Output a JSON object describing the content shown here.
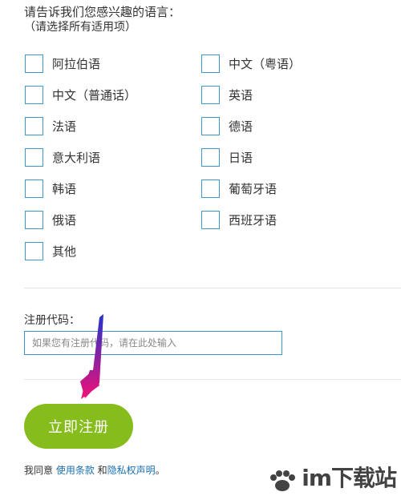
{
  "form": {
    "prompt": "请告诉我们您感兴趣的语言：",
    "prompt_sub": "（请选择所有适用项）",
    "languages": [
      {
        "label": "阿拉伯语",
        "checked": false
      },
      {
        "label": "中文（粤语）",
        "checked": false
      },
      {
        "label": "中文（普通话）",
        "checked": false
      },
      {
        "label": "英语",
        "checked": false
      },
      {
        "label": "法语",
        "checked": false
      },
      {
        "label": "德语",
        "checked": false
      },
      {
        "label": "意大利语",
        "checked": false
      },
      {
        "label": "日语",
        "checked": false
      },
      {
        "label": "韩语",
        "checked": false
      },
      {
        "label": "葡萄牙语",
        "checked": false
      },
      {
        "label": "俄语",
        "checked": false
      },
      {
        "label": "西班牙语",
        "checked": false
      },
      {
        "label": "其他",
        "checked": false
      }
    ],
    "code_label": "注册代码：",
    "code_placeholder": "如果您有注册代码，请在此处输入",
    "code_value": "",
    "register_label": "立即注册",
    "agree_prefix": "我同意 ",
    "terms_link": "使用条款",
    "agree_and": " 和",
    "privacy_link": "隐私权声明",
    "agree_suffix": "。"
  },
  "annotation": {
    "arrow_gradient": [
      "#2233cc",
      "#ee1177"
    ]
  },
  "watermark": {
    "text": "im下载站"
  },
  "colors": {
    "checkbox_border": "#3b98c9",
    "button": "#86bc1c",
    "link": "#1a6fb0"
  }
}
